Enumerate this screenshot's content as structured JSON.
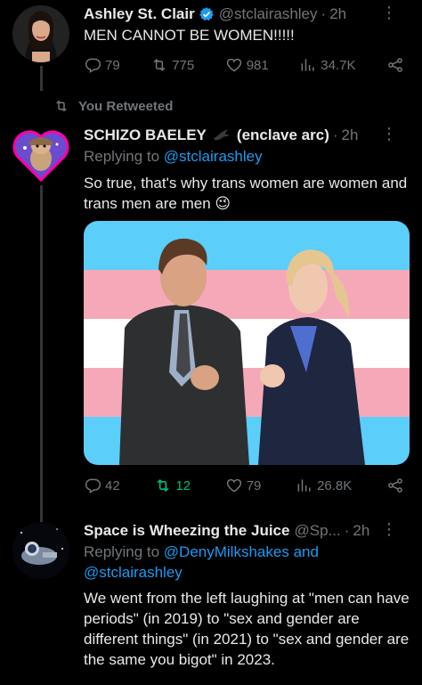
{
  "tweet1": {
    "name": "Ashley St. Clair",
    "handle": "@stclairashley",
    "sep": "·",
    "time": "2h",
    "text": "MEN CANNOT BE WOMEN!!!!!",
    "replies": "79",
    "retweets": "775",
    "likes": "981",
    "views": "34.7K"
  },
  "retweet_label": "You Retweeted",
  "tweet2": {
    "name": "SCHIZO BAELEY",
    "name_suffix": "(enclave arc)",
    "sep": "·",
    "time": "2h",
    "replying_prefix": "Replying to",
    "replying_to": "@stclairashley",
    "text": "So true, that's why trans women are women and trans men are men 😉",
    "replies": "42",
    "retweets": "12",
    "likes": "79",
    "views": "26.8K"
  },
  "tweet3": {
    "name": "Space is Wheezing the Juice",
    "handle": "@Sp...",
    "sep": "·",
    "time": "2h",
    "replying_prefix": "Replying to",
    "replying_to_1": "@DenyMilkshakes",
    "replying_and": "and",
    "replying_to_2": "@stclairashley",
    "text": "We went from the left laughing at \"men can have periods\" (in 2019) to \"sex and gender are different things\" (in 2021) to \"sex and gender are the same you bigot\" in 2023."
  },
  "colors": {
    "background": "#000000",
    "text": "#e7e9ea",
    "muted": "#71767b",
    "link": "#1d9bf0",
    "retweet": "#00ba7c",
    "verified": "#1d9bf0",
    "flag_blue": "#5bcefa",
    "flag_pink": "#f5a9b8",
    "flag_white": "#ffffff"
  },
  "icons": [
    "more-icon",
    "reply-icon",
    "retweet-icon",
    "like-icon",
    "views-icon",
    "share-icon",
    "verified-badge-icon"
  ]
}
